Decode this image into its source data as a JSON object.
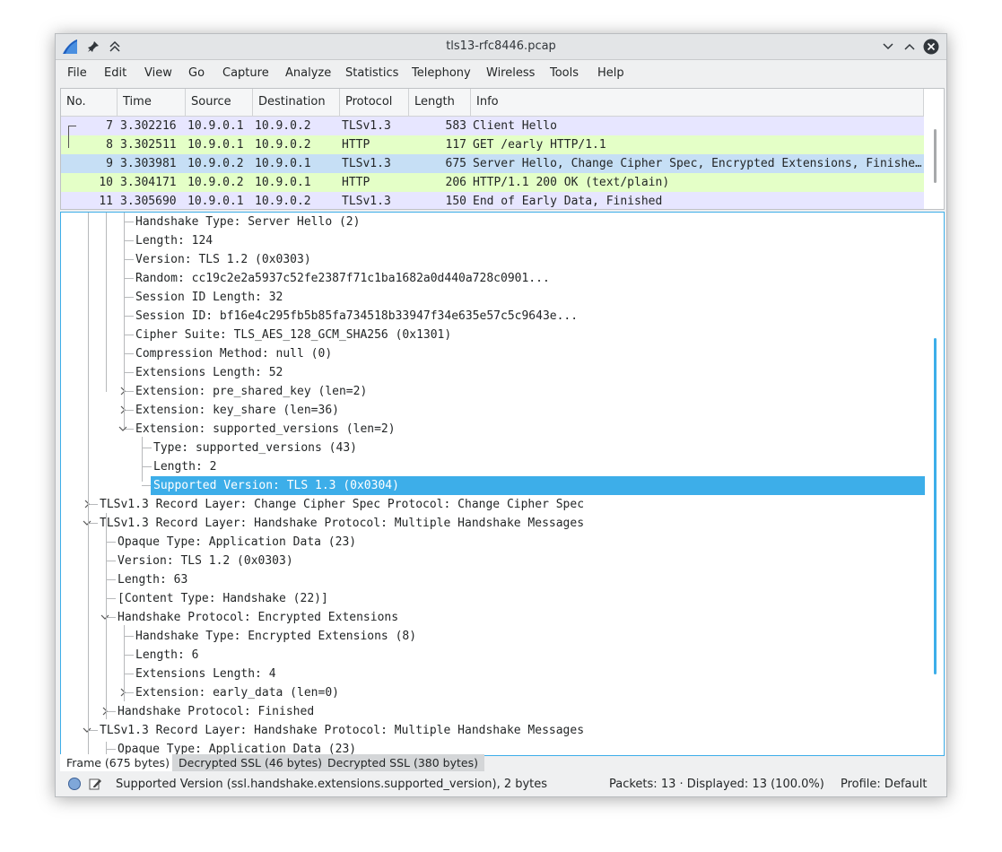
{
  "window": {
    "title": "tls13-rfc8446.pcap"
  },
  "menu": [
    "File",
    "Edit",
    "View",
    "Go",
    "Capture",
    "Analyze",
    "Statistics",
    "Telephony",
    "Wireless",
    "Tools",
    "Help"
  ],
  "packet_list": {
    "columns": [
      "No.",
      "Time",
      "Source",
      "Destination",
      "Protocol",
      "Length",
      "Info"
    ],
    "rows": [
      {
        "no": "7",
        "time": "3.302216",
        "src": "10.9.0.1",
        "dst": "10.9.0.2",
        "proto": "TLSv1.3",
        "len": "583",
        "info": "Client Hello",
        "color": "#e7e6ff"
      },
      {
        "no": "8",
        "time": "3.302511",
        "src": "10.9.0.1",
        "dst": "10.9.0.2",
        "proto": "HTTP",
        "len": "117",
        "info": "GET /early HTTP/1.1",
        "color": "#e4ffc7"
      },
      {
        "no": "9",
        "time": "3.303981",
        "src": "10.9.0.2",
        "dst": "10.9.0.1",
        "proto": "TLSv1.3",
        "len": "675",
        "info": "Server Hello, Change Cipher Spec, Encrypted Extensions, Finishe…",
        "color": "#c6dff5"
      },
      {
        "no": "10",
        "time": "3.304171",
        "src": "10.9.0.2",
        "dst": "10.9.0.1",
        "proto": "HTTP",
        "len": "206",
        "info": "HTTP/1.1 200 OK  (text/plain)",
        "color": "#e4ffc7"
      },
      {
        "no": "11",
        "time": "3.305690",
        "src": "10.9.0.1",
        "dst": "10.9.0.2",
        "proto": "TLSv1.3",
        "len": "150",
        "info": "End of Early Data, Finished",
        "color": "#e7e6ff"
      }
    ]
  },
  "details": [
    {
      "level": 2,
      "text": "Handshake Type: Server Hello (2)",
      "arrow": ""
    },
    {
      "level": 2,
      "text": "Length: 124",
      "arrow": ""
    },
    {
      "level": 2,
      "text": "Version: TLS 1.2 (0x0303)",
      "arrow": ""
    },
    {
      "level": 2,
      "text": "Random: cc19c2e2a5937c52fe2387f71c1ba1682a0d440a728c0901...",
      "arrow": ""
    },
    {
      "level": 2,
      "text": "Session ID Length: 32",
      "arrow": ""
    },
    {
      "level": 2,
      "text": "Session ID: bf16e4c295fb5b85fa734518b33947f34e635e57c5c9643e...",
      "arrow": ""
    },
    {
      "level": 2,
      "text": "Cipher Suite: TLS_AES_128_GCM_SHA256 (0x1301)",
      "arrow": ""
    },
    {
      "level": 2,
      "text": "Compression Method: null (0)",
      "arrow": ""
    },
    {
      "level": 2,
      "text": "Extensions Length: 52",
      "arrow": ""
    },
    {
      "level": 2,
      "text": "Extension: pre_shared_key (len=2)",
      "arrow": "collapsed"
    },
    {
      "level": 2,
      "text": "Extension: key_share (len=36)",
      "arrow": "collapsed"
    },
    {
      "level": 2,
      "text": "Extension: supported_versions (len=2)",
      "arrow": "expanded"
    },
    {
      "level": 3,
      "text": "Type: supported_versions (43)",
      "arrow": ""
    },
    {
      "level": 3,
      "text": "Length: 2",
      "arrow": ""
    },
    {
      "level": 3,
      "text": "Supported Version: TLS 1.3 (0x0304)",
      "arrow": "",
      "selected": true
    },
    {
      "level": 0,
      "text": "TLSv1.3 Record Layer: Change Cipher Spec Protocol: Change Cipher Spec",
      "arrow": "collapsed"
    },
    {
      "level": 0,
      "text": "TLSv1.3 Record Layer: Handshake Protocol: Multiple Handshake Messages",
      "arrow": "expanded"
    },
    {
      "level": 1,
      "text": "Opaque Type: Application Data (23)",
      "arrow": ""
    },
    {
      "level": 1,
      "text": "Version: TLS 1.2 (0x0303)",
      "arrow": ""
    },
    {
      "level": 1,
      "text": "Length: 63",
      "arrow": ""
    },
    {
      "level": 1,
      "text": "[Content Type: Handshake (22)]",
      "arrow": ""
    },
    {
      "level": 1,
      "text": "Handshake Protocol: Encrypted Extensions",
      "arrow": "expanded"
    },
    {
      "level": 2,
      "text": "Handshake Type: Encrypted Extensions (8)",
      "arrow": ""
    },
    {
      "level": 2,
      "text": "Length: 6",
      "arrow": ""
    },
    {
      "level": 2,
      "text": "Extensions Length: 4",
      "arrow": ""
    },
    {
      "level": 2,
      "text": "Extension: early_data (len=0)",
      "arrow": "collapsed"
    },
    {
      "level": 1,
      "text": "Handshake Protocol: Finished",
      "arrow": "collapsed"
    },
    {
      "level": 0,
      "text": "TLSv1.3 Record Layer: Handshake Protocol: Multiple Handshake Messages",
      "arrow": "expanded"
    },
    {
      "level": 1,
      "text": "Opaque Type: Application Data (23)",
      "arrow": ""
    }
  ],
  "tabs": [
    "Frame (675 bytes)",
    "Decrypted SSL (46 bytes)",
    "Decrypted SSL (380 bytes)"
  ],
  "status": {
    "field": "Supported Version (ssl.handshake.extensions.supported_version), 2 bytes",
    "packets": "Packets: 13 · Displayed: 13 (100.0%)",
    "profile": "Profile: Default"
  },
  "colors": {
    "accent": "#3daee9"
  }
}
